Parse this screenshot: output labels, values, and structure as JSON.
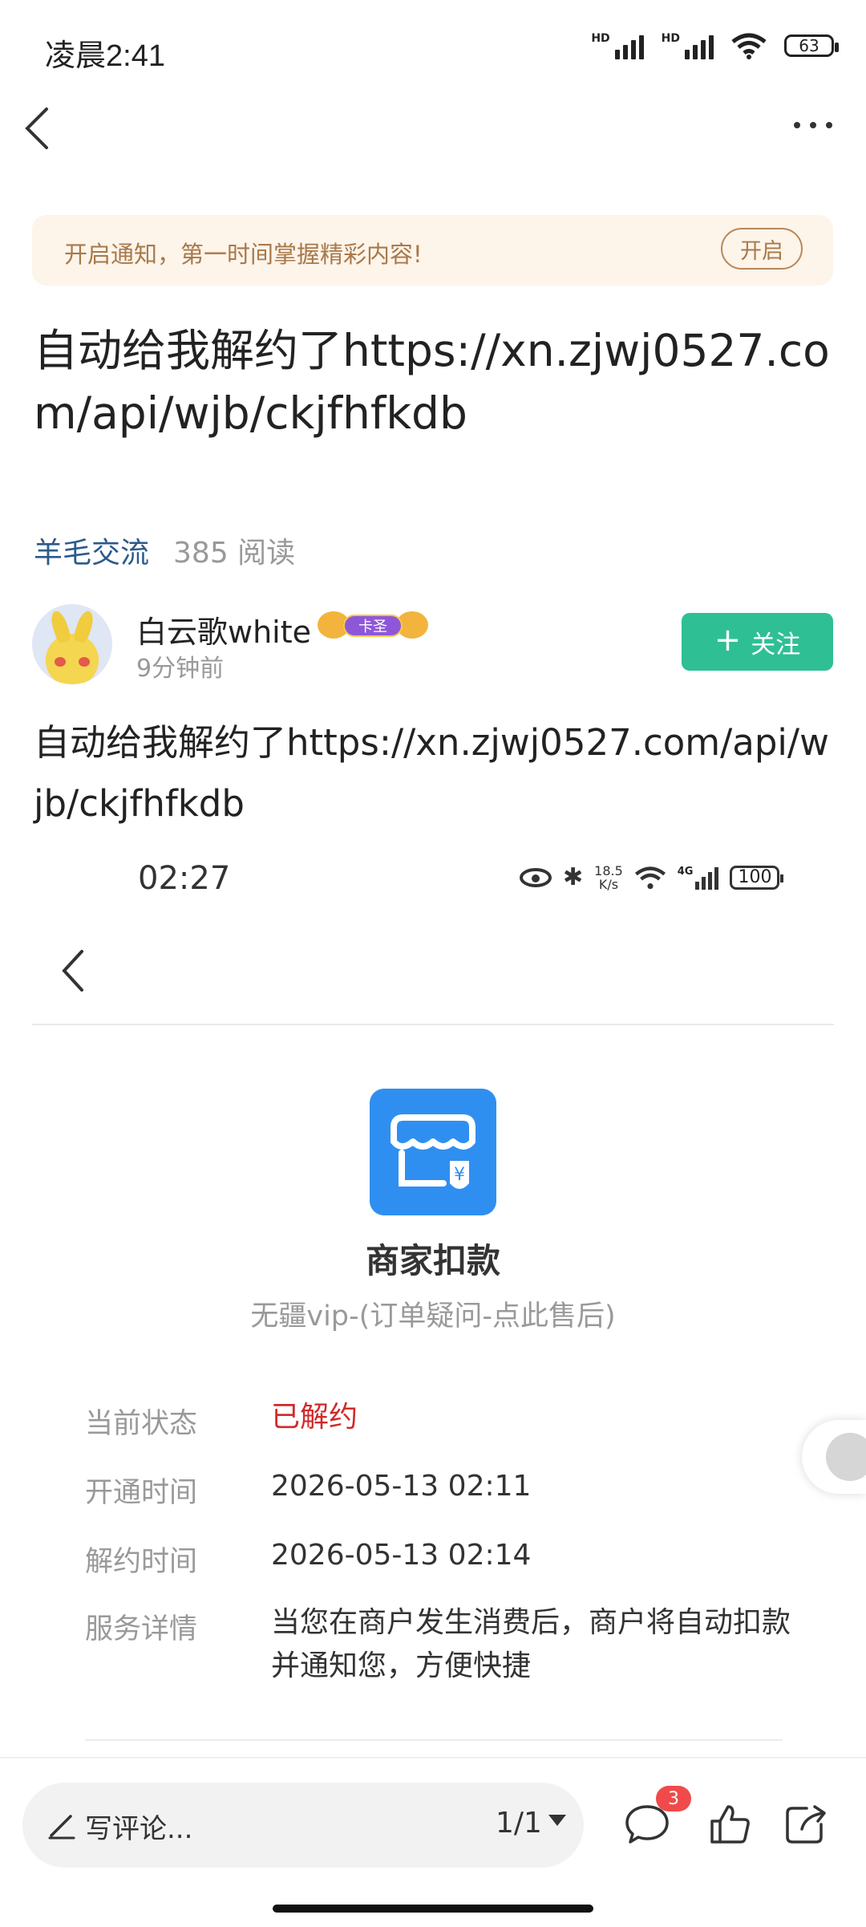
{
  "status_bar": {
    "time": "凌晨2:41",
    "hd_label": "HD",
    "battery": "63"
  },
  "notice": {
    "text": "开启通知，第一时间掌握精彩内容!",
    "button": "开启"
  },
  "post": {
    "title": "自动给我解约了https://xn.zjwj0527.com/api/wjb/ckjfhfkdb",
    "category": "羊毛交流",
    "reads": "385 阅读",
    "body": "自动给我解约了https://xn.zjwj0527.com/api/wjb/ckjfhfkdb"
  },
  "author": {
    "name": "白云歌white",
    "badge": "卡圣",
    "time": "9分钟前",
    "follow_label": "关注"
  },
  "embedded_screenshot": {
    "time": "02:27",
    "speed_top": "18.5",
    "speed_unit": "K/s",
    "network": "4G",
    "battery": "100",
    "app_title": "商家扣款",
    "app_subtitle": "无疆vip-(订单疑问-点此售后)",
    "details": [
      {
        "label": "当前状态",
        "value": "已解约"
      },
      {
        "label": "开通时间",
        "value": "2026-05-13 02:11"
      },
      {
        "label": "解约时间",
        "value": "2026-05-13 02:14"
      },
      {
        "label": "服务详情",
        "value": "当您在商户发生消费后，商户将自动扣款并通知您，方便快捷"
      }
    ]
  },
  "bottom_bar": {
    "comment_placeholder": "写评论...",
    "page_indicator": "1/1",
    "comment_count": "3"
  },
  "colors": {
    "accent_green": "#2fbf95",
    "link_blue": "#2b5a8c",
    "status_red": "#d12a2a",
    "app_icon_blue": "#2f8ff0",
    "notice_bg": "#fdf4ea"
  }
}
